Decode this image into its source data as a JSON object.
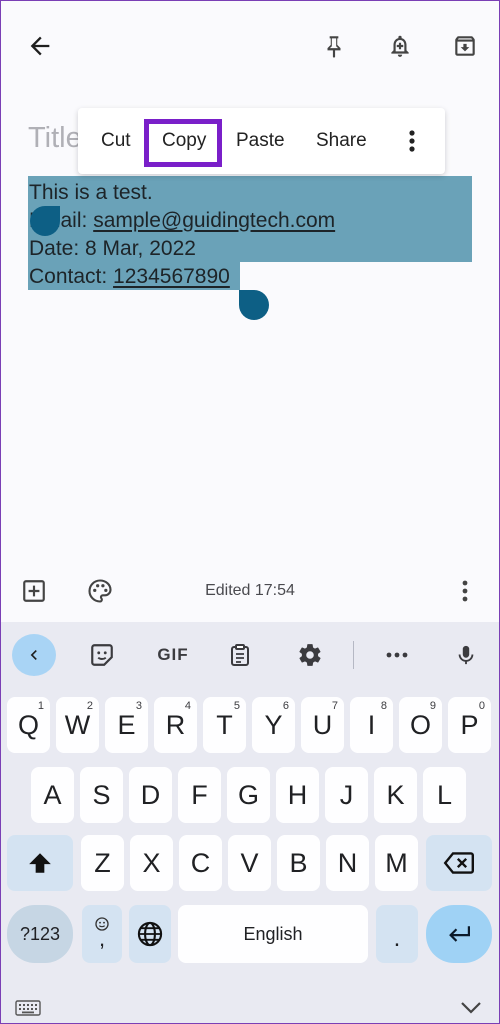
{
  "note": {
    "title_placeholder": "Title",
    "lines": [
      {
        "prefix": "This is a test.",
        "link": ""
      },
      {
        "prefix": "Email: ",
        "link": "sample@guidingtech.com"
      },
      {
        "prefix": "Date: 8 Mar, 2022",
        "link": ""
      },
      {
        "prefix": "Contact: ",
        "link": "1234567890"
      }
    ]
  },
  "context_menu": {
    "items": [
      "Cut",
      "Copy",
      "Paste",
      "Share"
    ]
  },
  "bottom_bar": {
    "edited": "Edited 17:54"
  },
  "keyboard": {
    "toolbar": {
      "gif": "GIF"
    },
    "row1": [
      {
        "l": "Q",
        "h": "1"
      },
      {
        "l": "W",
        "h": "2"
      },
      {
        "l": "E",
        "h": "3"
      },
      {
        "l": "R",
        "h": "4"
      },
      {
        "l": "T",
        "h": "5"
      },
      {
        "l": "Y",
        "h": "6"
      },
      {
        "l": "U",
        "h": "7"
      },
      {
        "l": "I",
        "h": "8"
      },
      {
        "l": "O",
        "h": "9"
      },
      {
        "l": "P",
        "h": "0"
      }
    ],
    "row2": [
      "A",
      "S",
      "D",
      "F",
      "G",
      "H",
      "J",
      "K",
      "L"
    ],
    "row3": [
      "Z",
      "X",
      "C",
      "V",
      "B",
      "N",
      "M"
    ],
    "sym_label": "?123",
    "comma_label": ",",
    "space_label": "English",
    "period_label": "."
  },
  "colors": {
    "selection": "#6aa2b8",
    "handle": "#0d5f85",
    "highlight": "#7a1fc9",
    "enter_key": "#9fd2f5"
  }
}
